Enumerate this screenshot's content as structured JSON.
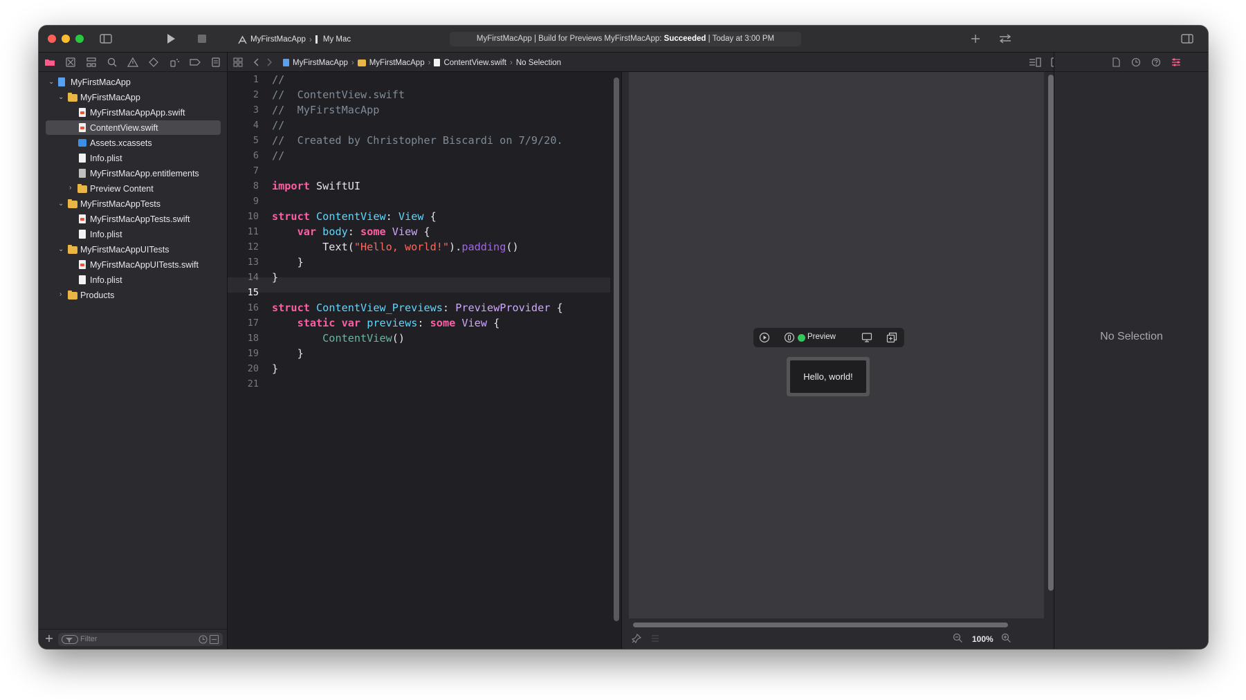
{
  "toolbar": {
    "scheme": "MyFirstMacApp",
    "destination": "My Mac",
    "status_prefix": "MyFirstMacApp | Build for Previews MyFirstMacApp: ",
    "status_result": "Succeeded",
    "status_suffix": " | Today at 3:00 PM"
  },
  "navigator": {
    "items": [
      {
        "label": "MyFirstMacApp"
      },
      {
        "label": "MyFirstMacApp"
      },
      {
        "label": "MyFirstMacAppApp.swift"
      },
      {
        "label": "ContentView.swift"
      },
      {
        "label": "Assets.xcassets"
      },
      {
        "label": "Info.plist"
      },
      {
        "label": "MyFirstMacApp.entitlements"
      },
      {
        "label": "Preview Content"
      },
      {
        "label": "MyFirstMacAppTests"
      },
      {
        "label": "MyFirstMacAppTests.swift"
      },
      {
        "label": "Info.plist"
      },
      {
        "label": "MyFirstMacAppUITests"
      },
      {
        "label": "MyFirstMacAppUITests.swift"
      },
      {
        "label": "Info.plist"
      },
      {
        "label": "Products"
      }
    ],
    "filter_placeholder": "Filter"
  },
  "jumpbar": {
    "crumbs": [
      "MyFirstMacApp",
      "MyFirstMacApp",
      "ContentView.swift",
      "No Selection"
    ]
  },
  "editor": {
    "current_line": 15,
    "lines": [
      [
        [
          "cm",
          "//"
        ]
      ],
      [
        [
          "cm",
          "//  ContentView.swift"
        ]
      ],
      [
        [
          "cm",
          "//  MyFirstMacApp"
        ]
      ],
      [
        [
          "cm",
          "//"
        ]
      ],
      [
        [
          "cm",
          "//  Created by Christopher Biscardi on 7/9/20."
        ]
      ],
      [
        [
          "cm",
          "//"
        ]
      ],
      [],
      [
        [
          "kw",
          "import"
        ],
        [
          "",
          " SwiftUI"
        ]
      ],
      [],
      [
        [
          "kw",
          "struct"
        ],
        [
          "",
          " "
        ],
        [
          "ty",
          "ContentView"
        ],
        [
          "",
          ": "
        ],
        [
          "ty",
          "View"
        ],
        [
          "",
          " {"
        ]
      ],
      [
        [
          "",
          "    "
        ],
        [
          "kw",
          "var"
        ],
        [
          "",
          " "
        ],
        [
          "ty",
          "body"
        ],
        [
          "",
          ": "
        ],
        [
          "kw",
          "some"
        ],
        [
          "",
          " "
        ],
        [
          "ty2",
          "View"
        ],
        [
          "",
          " {"
        ]
      ],
      [
        [
          "",
          "        Text("
        ],
        [
          "str",
          "\"Hello, world!\""
        ],
        [
          "",
          ")."
        ],
        [
          "fn",
          "padding"
        ],
        [
          "",
          "()"
        ]
      ],
      [
        [
          "",
          "    }"
        ]
      ],
      [
        [
          "",
          "}"
        ]
      ],
      [],
      [
        [
          "kw",
          "struct"
        ],
        [
          "",
          " "
        ],
        [
          "ty",
          "ContentView_Previews"
        ],
        [
          "",
          ": "
        ],
        [
          "ty2",
          "PreviewProvider"
        ],
        [
          "",
          " {"
        ]
      ],
      [
        [
          "",
          "    "
        ],
        [
          "kw",
          "static"
        ],
        [
          "",
          " "
        ],
        [
          "kw",
          "var"
        ],
        [
          "",
          " "
        ],
        [
          "ty",
          "previews"
        ],
        [
          "",
          ": "
        ],
        [
          "kw",
          "some"
        ],
        [
          "",
          " "
        ],
        [
          "ty2",
          "View"
        ],
        [
          "",
          " {"
        ]
      ],
      [
        [
          "",
          "        "
        ],
        [
          "id",
          "ContentView"
        ],
        [
          "",
          "()"
        ]
      ],
      [
        [
          "",
          "    }"
        ]
      ],
      [
        [
          "",
          "}"
        ]
      ],
      []
    ]
  },
  "canvas": {
    "preview_label": "Preview",
    "preview_text": "Hello, world!",
    "zoom": "100%"
  },
  "inspector": {
    "empty_label": "No Selection"
  }
}
